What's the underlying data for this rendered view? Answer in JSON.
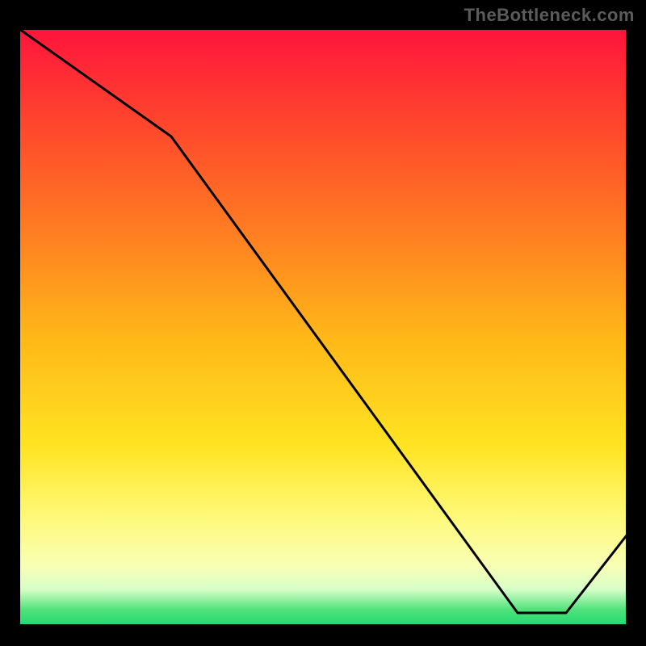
{
  "watermark": "TheBottleneck.com",
  "chart_data": {
    "type": "line",
    "title": "",
    "xlabel": "",
    "ylabel": "",
    "xlim": [
      0,
      100
    ],
    "ylim": [
      0,
      100
    ],
    "x": [
      0,
      25,
      82,
      90,
      100
    ],
    "values": [
      100,
      82,
      2,
      2,
      15
    ],
    "series_name": "",
    "legend": {
      "label": "",
      "position": "bottom-right"
    },
    "gradient_colors": {
      "top": "#ff143c",
      "mid_upper": "#ff7a22",
      "mid": "#ffe422",
      "lower": "#f8ffb4",
      "bottom": "#23d873"
    },
    "line_color": "#000000",
    "axis_color": "#000000",
    "background": "#000000"
  }
}
